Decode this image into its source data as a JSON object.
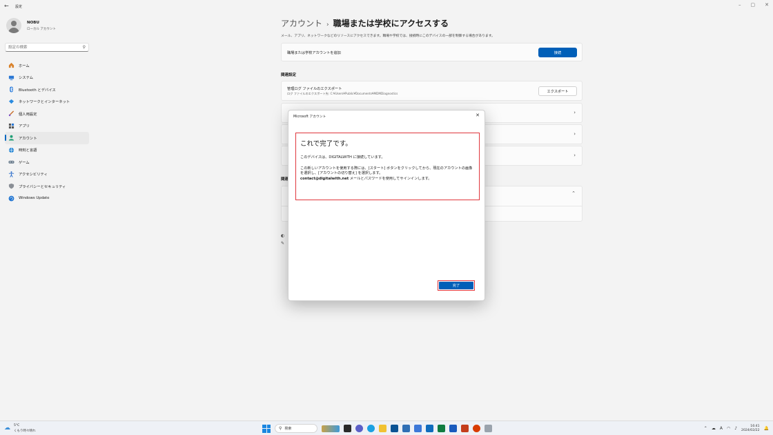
{
  "window": {
    "back_glyph": "←",
    "title": "設定",
    "controls": [
      "–",
      "▢",
      "✕"
    ]
  },
  "user": {
    "name": "NOBU",
    "account_type": "ローカル アカウント"
  },
  "search": {
    "placeholder": "設定の検索",
    "icon": "search-icon"
  },
  "sidebar": {
    "items": [
      {
        "label": "ホーム",
        "icon": "home-icon",
        "active": false
      },
      {
        "label": "システム",
        "icon": "system-icon",
        "active": false
      },
      {
        "label": "Bluetooth とデバイス",
        "icon": "bluetooth-icon",
        "active": false
      },
      {
        "label": "ネットワークとインターネット",
        "icon": "network-icon",
        "active": false
      },
      {
        "label": "個人用設定",
        "icon": "brush-icon",
        "active": false
      },
      {
        "label": "アプリ",
        "icon": "apps-icon",
        "active": false
      },
      {
        "label": "アカウント",
        "icon": "account-icon",
        "active": true
      },
      {
        "label": "時刻と言語",
        "icon": "globe-icon",
        "active": false
      },
      {
        "label": "ゲーム",
        "icon": "gamepad-icon",
        "active": false
      },
      {
        "label": "アクセシビリティ",
        "icon": "accessibility-icon",
        "active": false
      },
      {
        "label": "プライバシーとセキュリティ",
        "icon": "shield-icon",
        "active": false
      },
      {
        "label": "Windows Update",
        "icon": "update-icon",
        "active": false
      }
    ]
  },
  "main": {
    "breadcrumb_parent": "アカウント",
    "breadcrumb_sep": "›",
    "breadcrumb_current": "職場または学校にアクセスする",
    "description": "メール、アプリ、ネットワークなどのリソースにアクセスできます。職場や学校では、接続時にこのデバイスの一部を制御する場合があります。",
    "add_account_label": "職場または学校アカウントを追加",
    "connect_button": "接続",
    "related_title": "関連設定",
    "log_title": "管理ログ ファイルのエクスポート",
    "log_path": "ログ ファイルのエクスポート先: C:¥Users¥Public¥Documents¥MDMDiagnostics",
    "export_button": "エクスポート",
    "row2_partial": "",
    "help_title": "関連",
    "chevron": "›",
    "expand": "⌃"
  },
  "dialog": {
    "title": "Microsoft アカウント",
    "close": "✕",
    "heading": "これで完了です。",
    "line1": "このデバイスは、DIGITALWITH に接続しています。",
    "para_part1": "この新しいアカウントを使用する際には、[スタート] ボタンをクリックしてから、現在のアカウントの画像を選択し、[アカウントの切り替え] を選択します。",
    "para_email": "contact@digitalwith.net",
    "para_part2": " メールとパスワードを使用してサインインします。",
    "done_button": "完了"
  },
  "taskbar": {
    "temperature": "5°C",
    "condition": "くもり時々晴れ",
    "search_label": "検索",
    "time": "16:41",
    "date": "2024/02/22",
    "ime": "A"
  },
  "colors": {
    "accent": "#005fb8",
    "highlight_border": "#e0353b"
  }
}
